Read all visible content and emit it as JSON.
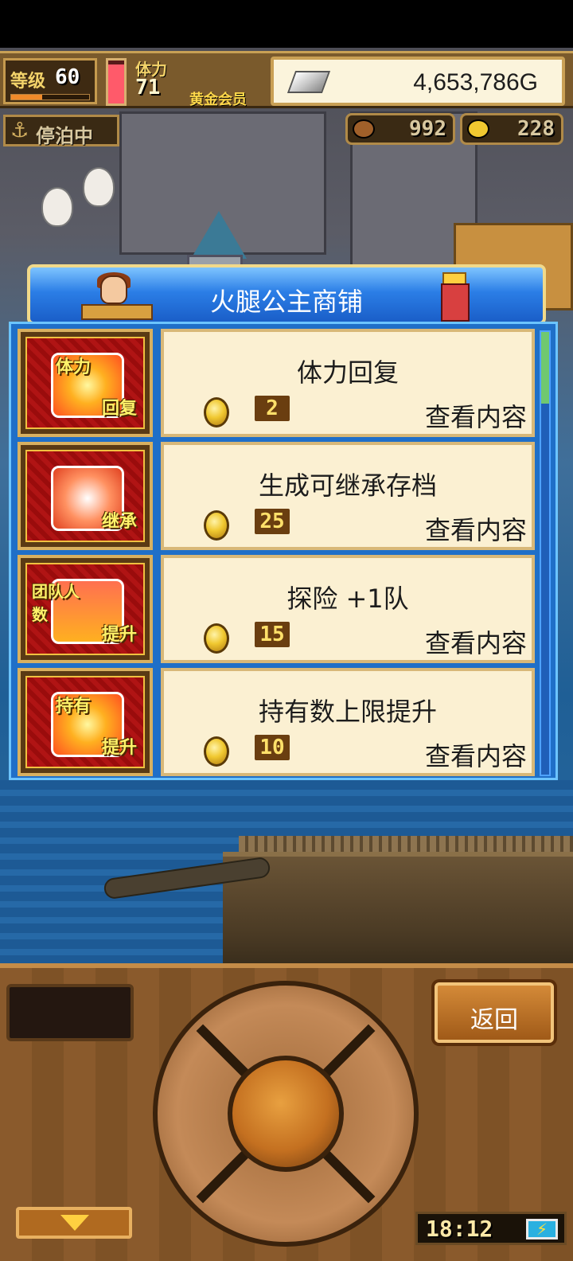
{
  "hud": {
    "level_label": "等级",
    "level": "60",
    "xp_fraction": 0.4,
    "stamina_label": "体力",
    "stamina": "71",
    "stamina_fraction": 0.9,
    "vip_label": "黄金会员",
    "gold": "4,653,786G"
  },
  "status": {
    "dock_label": "停泊中"
  },
  "resources": {
    "medals": "992",
    "coins": "228"
  },
  "shop": {
    "title": "火腿公主商铺",
    "items": [
      {
        "icon_top": "体力",
        "icon_bottom": "回复",
        "name": "体力回复",
        "price": "2",
        "view_label": "查看内容"
      },
      {
        "icon_top": "",
        "icon_bottom": "继承",
        "name": "生成可继承存档",
        "price": "25",
        "view_label": "查看内容"
      },
      {
        "icon_top": "团队人数",
        "icon_bottom": "提升",
        "name": "探险 +1队",
        "price": "15",
        "view_label": "查看内容"
      },
      {
        "icon_top": "持有",
        "icon_bottom": "提升",
        "name": "持有数上限提升",
        "price": "10",
        "view_label": "查看内容"
      }
    ]
  },
  "controls": {
    "back_label": "返回",
    "clock": "18:12",
    "battery_glyph": "⚡"
  },
  "colors": {
    "panel_blue": "#1f6fc8",
    "card_bg": "#fbf0d2",
    "wood": "#8a5a2c",
    "price_bg": "#6a3e10"
  }
}
